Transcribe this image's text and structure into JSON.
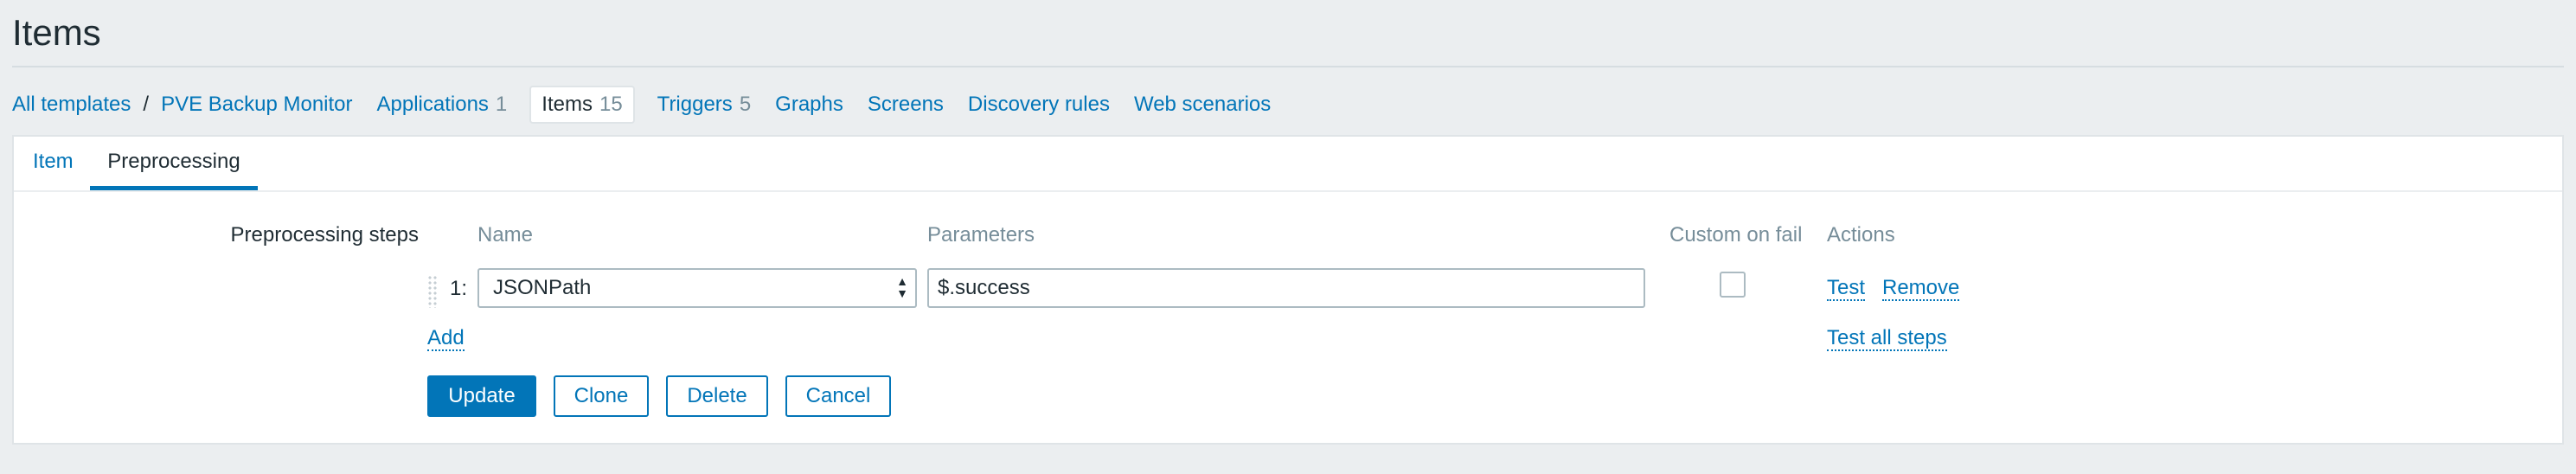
{
  "page": {
    "title": "Items"
  },
  "nav": {
    "breadcrumb": [
      {
        "label": "All templates"
      },
      {
        "label": "PVE Backup Monitor"
      }
    ],
    "separator": "/",
    "tabs": [
      {
        "label": "Applications",
        "count": "1"
      },
      {
        "label": "Items",
        "count": "15",
        "active": true
      },
      {
        "label": "Triggers",
        "count": "5"
      },
      {
        "label": "Graphs",
        "count": ""
      },
      {
        "label": "Screens",
        "count": ""
      },
      {
        "label": "Discovery rules",
        "count": ""
      },
      {
        "label": "Web scenarios",
        "count": ""
      }
    ]
  },
  "form_tabs": {
    "item": "Item",
    "preprocessing": "Preprocessing"
  },
  "preprocessing": {
    "label": "Preprocessing steps",
    "columns": {
      "name": "Name",
      "parameters": "Parameters",
      "custom_on_fail": "Custom on fail",
      "actions": "Actions"
    },
    "steps": [
      {
        "number": "1:",
        "name": "JSONPath",
        "parameter": "$.success",
        "custom_on_fail": false,
        "actions": {
          "test": "Test",
          "remove": "Remove"
        }
      }
    ],
    "add_label": "Add",
    "test_all_label": "Test all steps"
  },
  "buttons": {
    "update": "Update",
    "clone": "Clone",
    "delete": "Delete",
    "cancel": "Cancel"
  },
  "colors": {
    "accent": "#0275b8",
    "background": "#ebeef0",
    "text": "#1f2c33",
    "muted": "#768d99"
  }
}
